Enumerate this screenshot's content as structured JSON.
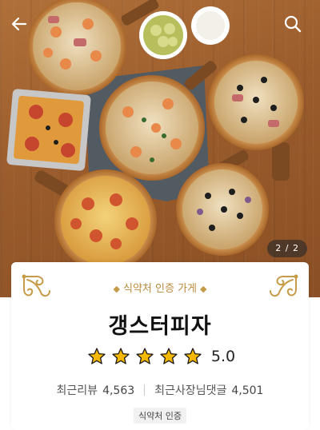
{
  "hero": {
    "image_counter": "2 / 2",
    "icons": {
      "back": "back-arrow-icon",
      "search": "search-icon"
    }
  },
  "store": {
    "certification_banner": "식약처 인증 가게",
    "name": "갱스터피자",
    "rating": {
      "stars": 5,
      "max": 5,
      "score": "5.0"
    },
    "recent_reviews": {
      "label": "최근리뷰",
      "count": "4,563"
    },
    "owner_replies": {
      "label": "최근사장님댓글",
      "count": "4,501"
    },
    "cert_badge": "식약처 인증"
  },
  "colors": {
    "gold": "#b88a3c",
    "star": "#f5b800",
    "table_wood": "#9a5c2c"
  }
}
